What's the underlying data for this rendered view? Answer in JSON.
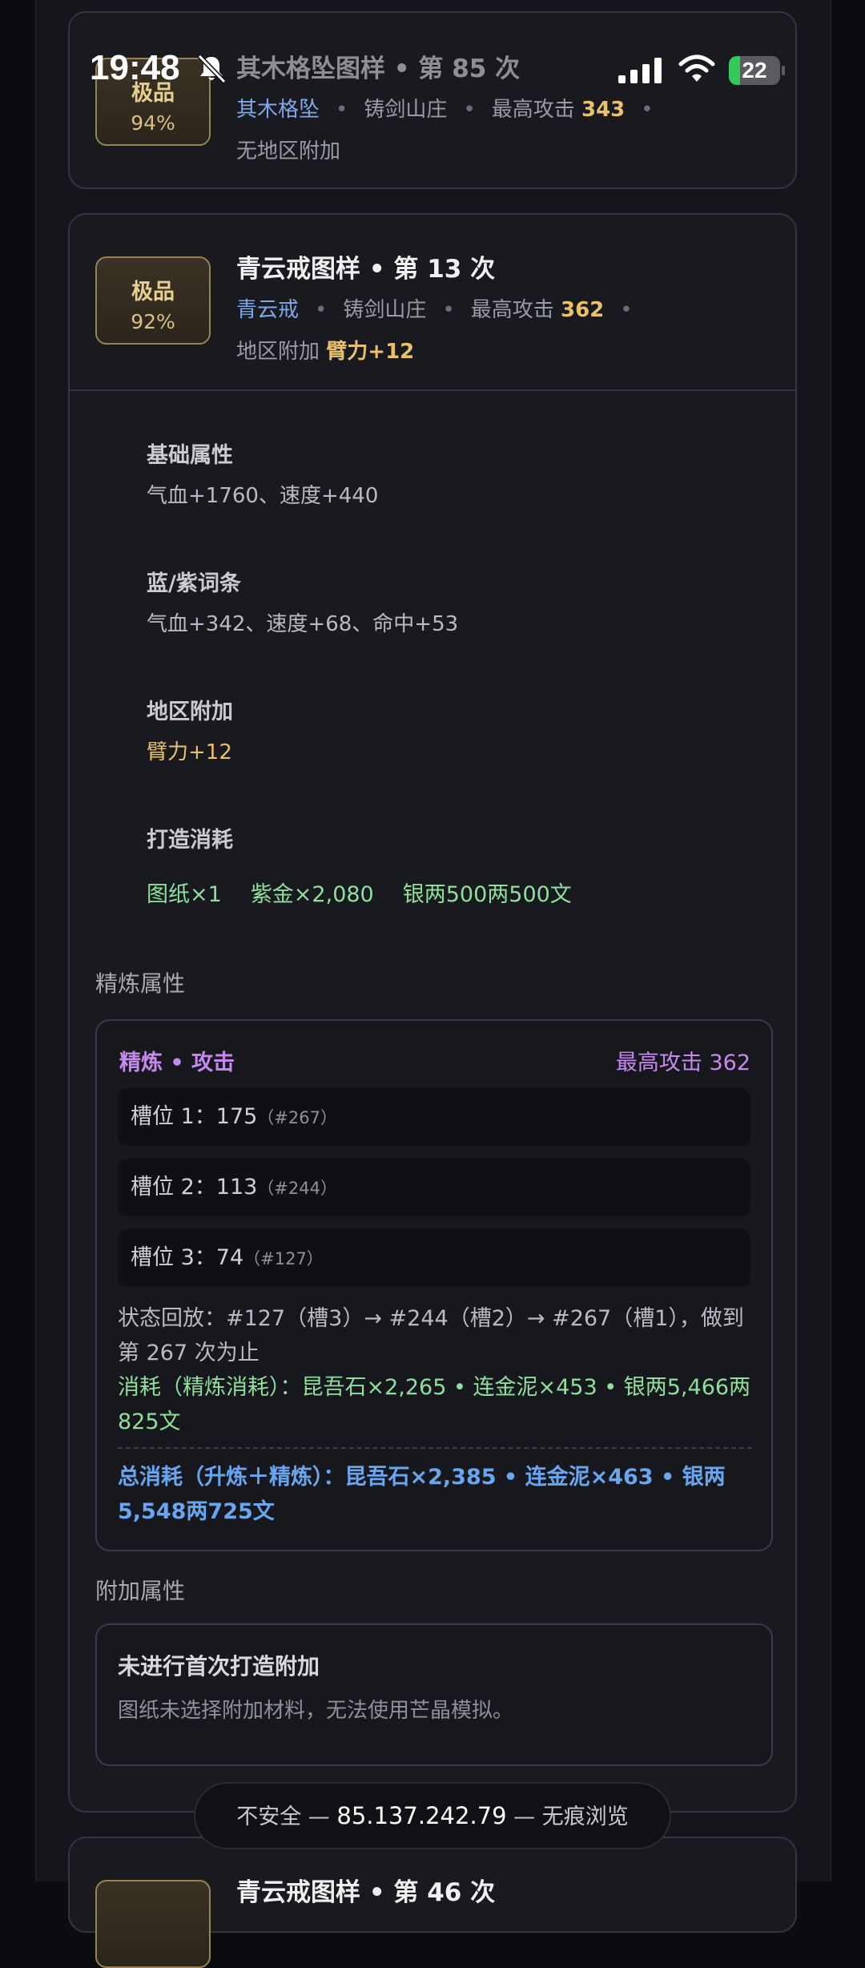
{
  "status_bar": {
    "time": "19:48",
    "battery": "22"
  },
  "card_prev": {
    "grade": "极品",
    "grade_pct": "94%",
    "title": "其木格坠图样 • 第 85 次",
    "item": "其木格坠",
    "place": "铸剑山庄",
    "max_atk_label": "最高攻击",
    "max_atk": "343",
    "bonus_line": "无地区附加"
  },
  "card_main": {
    "grade": "极品",
    "grade_pct": "92%",
    "title": "青云戒图样 • 第 13 次",
    "item": "青云戒",
    "place": "铸剑山庄",
    "max_atk_label": "最高攻击",
    "max_atk": "362",
    "bonus_label": "地区附加",
    "bonus_value": "臂力+12",
    "sections": {
      "base_title": "基础属性",
      "base_value": "气血+1760、速度+440",
      "affix_title": "蓝/紫词条",
      "affix_value": "气血+342、速度+68、命中+53",
      "region_title": "地区附加",
      "region_value": "臂力+12",
      "forge_title": "打造消耗",
      "forge_costs": [
        "图纸×1",
        "紫金×2,080",
        "银两500两500文"
      ]
    },
    "refine": {
      "label": "精炼属性",
      "header": "精炼 • 攻击",
      "max": "最高攻击 362",
      "slots": [
        {
          "text": "槽位 1：175",
          "sub": "（#267）"
        },
        {
          "text": "槽位 2：113",
          "sub": "（#244）"
        },
        {
          "text": "槽位 3：74",
          "sub": "（#127）"
        }
      ],
      "replay": "状态回放：#127（槽3）→ #244（槽2）→ #267（槽1），做到第 267 次为止",
      "consume": "消耗（精炼消耗）：昆吾石×2,265 • 连金泥×453 • 银两5,466两825文",
      "total": "总消耗（升炼＋精炼）：昆吾石×2,385 • 连金泥×463 • 银两5,548两725文"
    },
    "addon": {
      "label": "附加属性",
      "title": "未进行首次打造附加",
      "desc": "图纸未选择附加材料，无法使用芒晶模拟。"
    }
  },
  "card_next": {
    "title": "青云戒图样 • 第 46 次"
  },
  "url_bar": {
    "prefix": "不安全 —",
    "host": "85.137.242.79",
    "suffix": "— 无痕浏览"
  },
  "colors": {
    "accent_gold": "#e9c16a",
    "link_blue": "#7ea8e8",
    "refine_purple": "#c789f0",
    "cost_green": "#8ee09b",
    "total_blue": "#6aa6f0"
  }
}
